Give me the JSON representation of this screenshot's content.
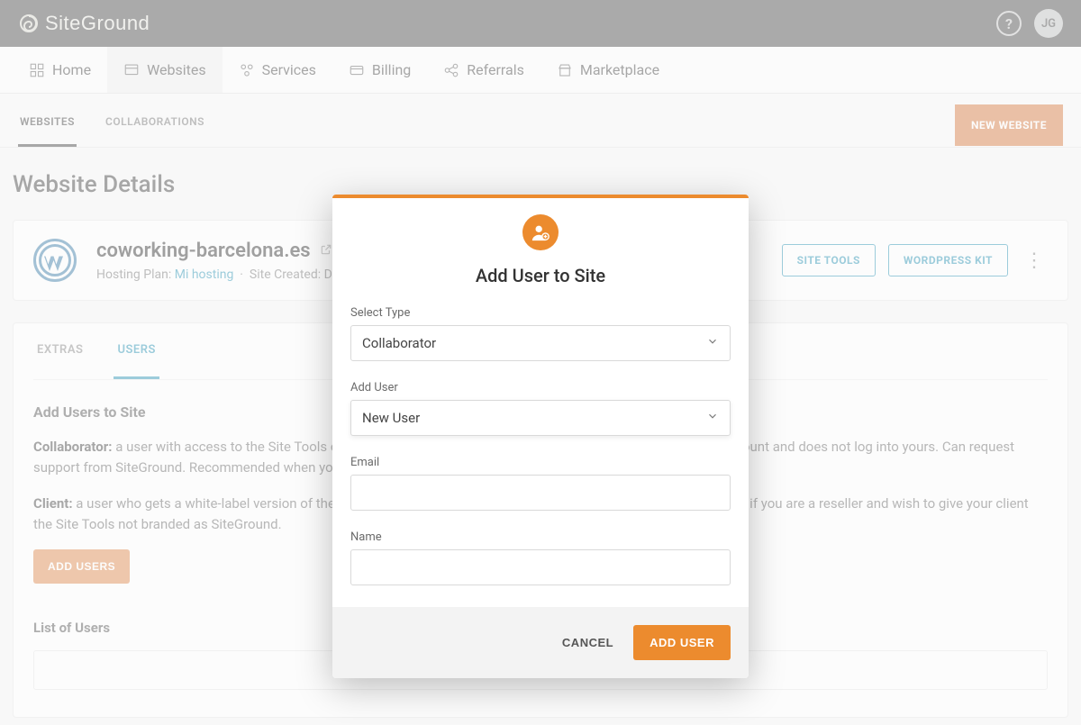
{
  "brand": "SiteGround",
  "user_initials": "JG",
  "nav": {
    "home": "Home",
    "websites": "Websites",
    "services": "Services",
    "billing": "Billing",
    "referrals": "Referrals",
    "marketplace": "Marketplace"
  },
  "subtabs": {
    "websites": "WEBSITES",
    "collaborations": "COLLABORATIONS",
    "new_website": "NEW WEBSITE"
  },
  "page_title": "Website Details",
  "site": {
    "domain": "coworking-barcelona.es",
    "hosting_plan_label": "Hosting Plan:",
    "hosting_plan_value": "Mi hosting",
    "site_created_label": "Site Created: D",
    "site_tools": "SITE TOOLS",
    "wordpress_kit": "WORDPRESS KIT"
  },
  "inner_tabs": {
    "extras": "EXTRAS",
    "users": "USERS"
  },
  "users_panel": {
    "title": "Add Users to Site",
    "collab_label": "Collaborator:",
    "collab_desc": " a user with access to the Site Tools of your website. That user has a separate, non-admin SiteGround account and does not log into yours. Can request support from SiteGround. Recommended when you hire a developer/designer/agency to create on your site.",
    "client_label": "Client:",
    "client_desc": " a user who gets a white-label version of the Site Tools. Cannot request support from SiteGround. Recommended if you are a reseller and wish to give your client the Site Tools not branded as SiteGround.",
    "add_users_btn": "ADD USERS",
    "list_title": "List of Users"
  },
  "modal": {
    "title": "Add User to Site",
    "type_label": "Select Type",
    "type_value": "Collaborator",
    "add_user_label": "Add User",
    "add_user_value": "New User",
    "email_label": "Email",
    "name_label": "Name",
    "cancel": "CANCEL",
    "submit": "ADD USER"
  }
}
